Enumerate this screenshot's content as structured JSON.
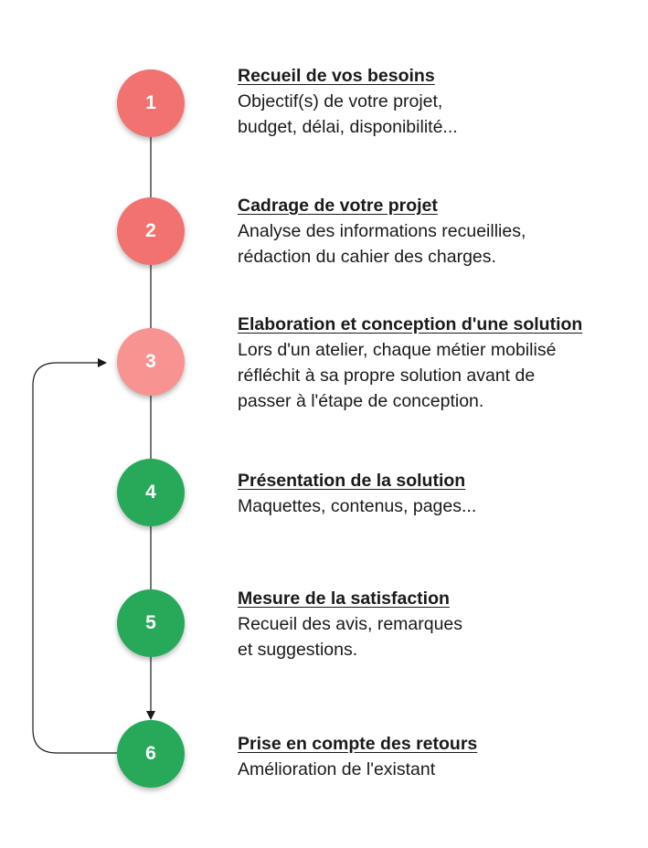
{
  "colors": {
    "red": "#f2726f",
    "light_red": "#f79390",
    "green": "#27a95a",
    "line": "#1a1a1a"
  },
  "steps": [
    {
      "number": "1",
      "title": "Recueil de vos besoins",
      "description": "Objectif(s) de votre projet,\nbudget, délai, disponibilité...",
      "color": "#f2726f"
    },
    {
      "number": "2",
      "title": "Cadrage de votre projet",
      "description": "Analyse des informations recueillies,\nrédaction du cahier des charges.",
      "color": "#f2726f"
    },
    {
      "number": "3",
      "title": "Elaboration et conception d'une solution",
      "description": "Lors d'un atelier, chaque métier mobilisé\nréfléchit à sa propre solution avant de\npasser à l'étape de conception.",
      "color": "#f79390"
    },
    {
      "number": "4",
      "title": "Présentation de la solution",
      "description": "Maquettes, contenus, pages...",
      "color": "#27a95a"
    },
    {
      "number": "5",
      "title": "Mesure de la satisfaction",
      "description": "Recueil des avis, remarques\net suggestions.",
      "color": "#27a95a"
    },
    {
      "number": "6",
      "title": "Prise en compte des retours",
      "description": "Amélioration de l'existant",
      "color": "#27a95a"
    }
  ]
}
